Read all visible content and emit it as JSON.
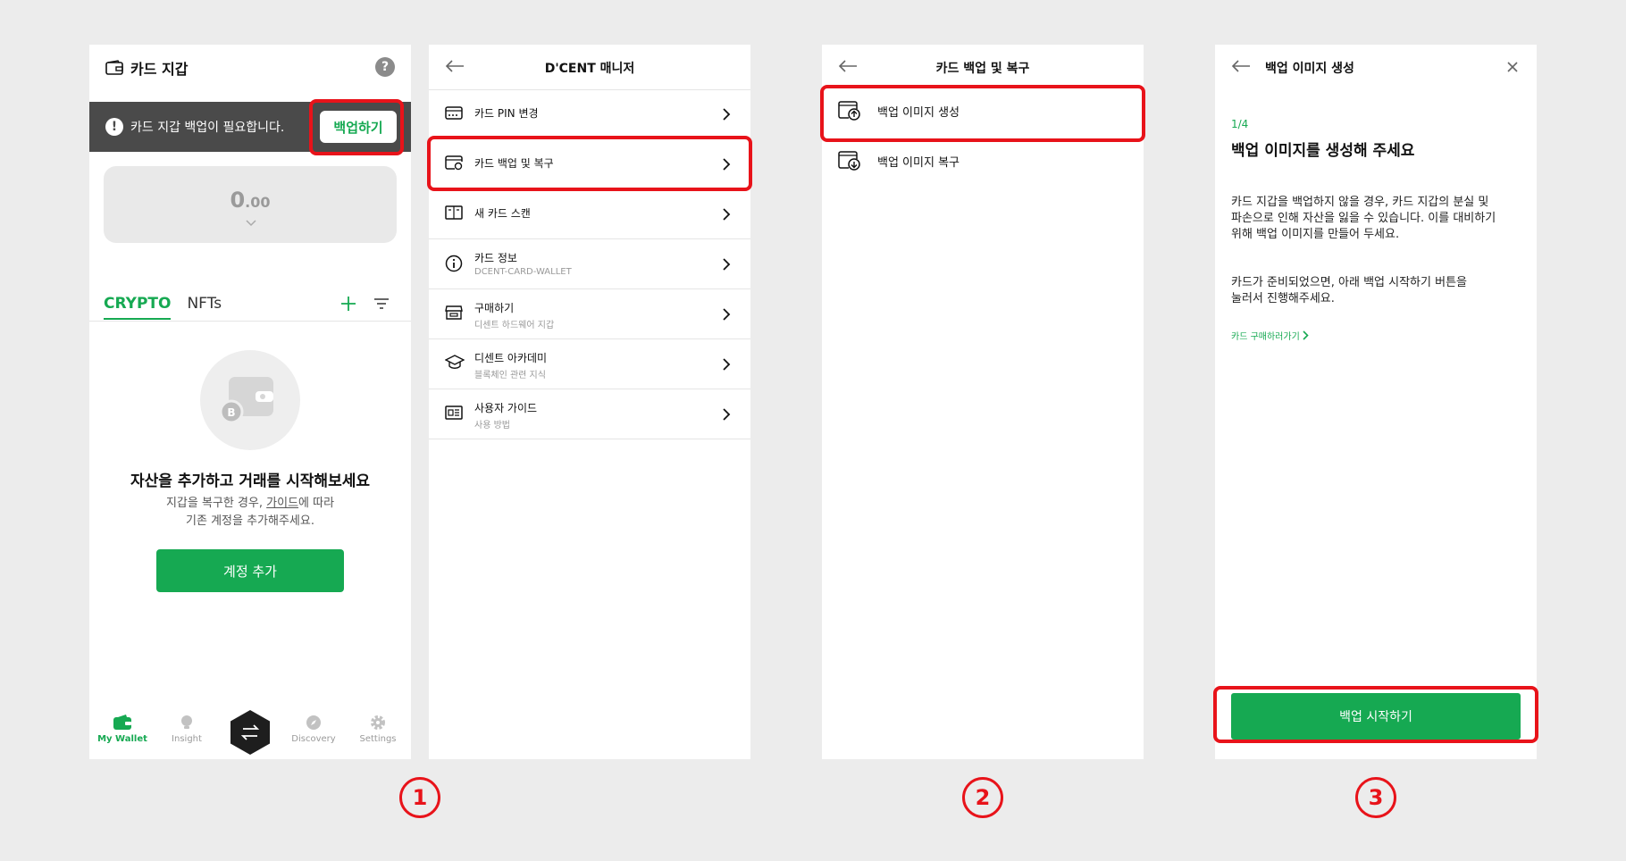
{
  "colors": {
    "accent": "#16a952",
    "highlight": "#e8131a",
    "banner": "#4a4a4a"
  },
  "steps": [
    "1",
    "2",
    "3"
  ],
  "screen1": {
    "title": "카드 지갑",
    "help_label": "?",
    "banner_text": "카드 지갑 백업이 필요합니다.",
    "backup_button": "백업하기",
    "balance_int": "0",
    "balance_dec": ".00",
    "tabs": [
      "CRYPTO",
      "NFTs"
    ],
    "empty_title": "자산을 추가하고 거래를 시작해보세요",
    "empty_sub_1": "지갑을 복구한 경우, ",
    "empty_sub_link": "가이드",
    "empty_sub_2": "에 따라",
    "empty_sub_3": "기존 계정을 추가해주세요.",
    "add_account_button": "계정 추가",
    "tabbar": [
      "My Wallet",
      "Insight",
      "Discovery",
      "Settings"
    ]
  },
  "screen2": {
    "title": "D'CENT 매니저",
    "items": [
      {
        "label": "카드 PIN 변경",
        "sub": "",
        "icon": "card-icon"
      },
      {
        "label": "카드 백업 및 복구",
        "sub": "",
        "icon": "card-sync-icon"
      },
      {
        "label": "새 카드 스캔",
        "sub": "",
        "icon": "book-icon"
      },
      {
        "label": "카드 정보",
        "sub": "DCENT-CARD-WALLET",
        "icon": "info-icon"
      },
      {
        "label": "구매하기",
        "sub": "디센트 하드웨어 지갑",
        "icon": "store-icon"
      },
      {
        "label": "디센트 아카데미",
        "sub": "블록체인 관련 지식",
        "icon": "graduation-cap-icon"
      },
      {
        "label": "사용자 가이드",
        "sub": "사용 방법",
        "icon": "guide-icon"
      }
    ]
  },
  "screen3": {
    "title": "카드 백업 및 복구",
    "items": [
      {
        "label": "백업 이미지 생성",
        "icon": "backup-upload-icon"
      },
      {
        "label": "백업 이미지 복구",
        "icon": "backup-download-icon"
      }
    ]
  },
  "screen4": {
    "title": "백업 이미지 생성",
    "step_count": "1/4",
    "heading": "백업 이미지를 생성해 주세요",
    "body1_l1": "카드 지갑을 백업하지 않을 경우, 카드 지갑의 분실 및",
    "body1_l2": "파손으로 인해 자산을 잃을 수 있습니다. 이를 대비하기",
    "body1_l3": "위해 백업 이미지를 만들어 두세요.",
    "body2_l1": "카드가 준비되었으면, 아래 백업 시작하기 버튼을",
    "body2_l2": "눌러서 진행해주세요.",
    "buy_link": "카드 구매하러가기",
    "start_button": "백업 시작하기"
  }
}
